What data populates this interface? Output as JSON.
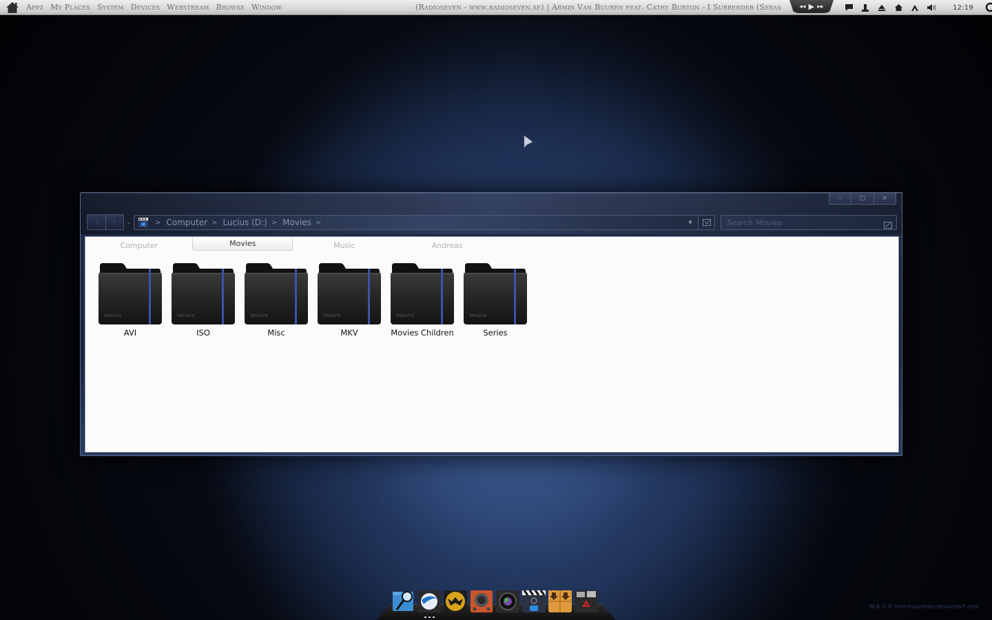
{
  "menubar": {
    "items": [
      "Appz",
      "My Places",
      "System",
      "Devices",
      "Webstream",
      "Browse",
      "Window"
    ],
    "now_playing": "(Ezzy Sweet Remix) (Radioseven - www.radioseven.se) | Armin Van Buuren feat. Cathy Burton - I Surrender (Sebas",
    "media": {
      "prev": "◂◂",
      "play": "▶",
      "next": "▸▸"
    },
    "tray_icons": [
      "chat-icon",
      "user-icon",
      "eject-icon",
      "home-icon",
      "up-arrow-icon",
      "volume-icon"
    ],
    "clock": "12:19"
  },
  "window": {
    "caption": {
      "minimize": "–",
      "maximize": "□",
      "close": "×"
    },
    "nav": {
      "back": "‹",
      "forward": "›",
      "recent": "⌄"
    },
    "breadcrumb": [
      "Computer",
      "Lucius (D:)",
      "Movies"
    ],
    "search": {
      "placeholder": "Search Movies",
      "value": ""
    },
    "tabs": [
      {
        "label": "Computer",
        "active": false
      },
      {
        "label": "Movies",
        "active": true
      },
      {
        "label": "Music",
        "active": false
      },
      {
        "label": "Andreas",
        "active": false
      }
    ],
    "folders": [
      {
        "name": "AVI",
        "badge": "Securo"
      },
      {
        "name": "ISO",
        "badge": "Securo"
      },
      {
        "name": "Misc",
        "badge": "Securo"
      },
      {
        "name": "MKV",
        "badge": "Securo"
      },
      {
        "name": "Movies Children",
        "badge": "Securo"
      },
      {
        "name": "Series",
        "badge": "Securo"
      }
    ]
  },
  "dock": {
    "apps": [
      "finder-search",
      "browser",
      "media-player",
      "speaker",
      "camera",
      "video-editor",
      "downloads",
      "trash"
    ]
  },
  "credit": "BLR // © skm-industries.deviantart.com",
  "colors": {
    "accent_blue": "#3d5a9e",
    "folder_dark": "#1c1c1c",
    "menubar_text": "#6d6d6d"
  }
}
